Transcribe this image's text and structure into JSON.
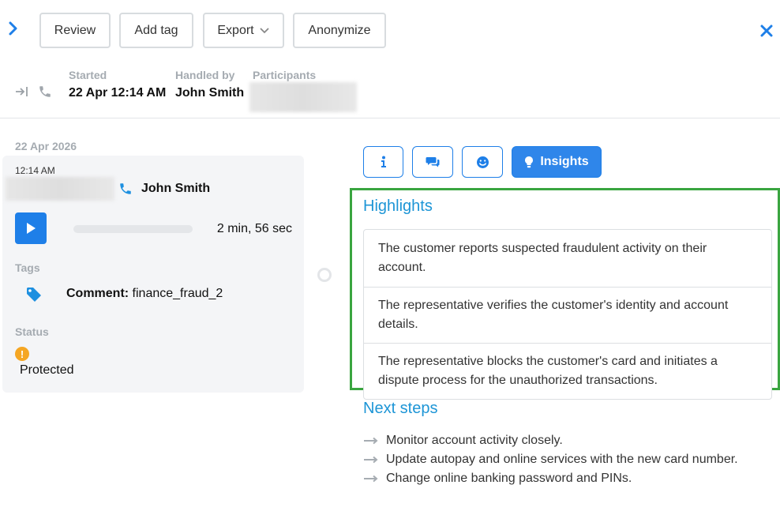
{
  "toolbar": {
    "review_label": "Review",
    "add_tag_label": "Add tag",
    "export_label": "Export",
    "anonymize_label": "Anonymize"
  },
  "meta": {
    "started_label": "Started",
    "started_value": "22 Apr 12:14 AM",
    "handled_by_label": "Handled by",
    "handled_by_value": "John Smith",
    "participants_label": "Participants"
  },
  "conversation": {
    "date": "22 Apr 2026",
    "time": "12:14 AM",
    "agent": "John Smith",
    "duration": "2 min, 56 sec",
    "tags_label": "Tags",
    "tag_key": "Comment:",
    "tag_value": " finance_fraud_2",
    "status_label": "Status",
    "status_value": "Protected"
  },
  "tabs": {
    "insights_label": "Insights"
  },
  "insights": {
    "highlights_title": "Highlights",
    "highlights": [
      "The customer reports suspected fraudulent activity on their account.",
      "The representative verifies the customer's identity and account details.",
      "The representative blocks the customer's card and initiates a dispute process for the unauthorized transactions."
    ],
    "next_steps_title": "Next steps",
    "next_steps": [
      "Monitor account activity closely.",
      "Update autopay and online services with the new card number.",
      "Change online banking password and PINs."
    ]
  },
  "colors": {
    "accent": "#1e7fe8",
    "section_title": "#1d95d6",
    "highlight_border": "#3aa540",
    "status_warning": "#f5a623"
  }
}
